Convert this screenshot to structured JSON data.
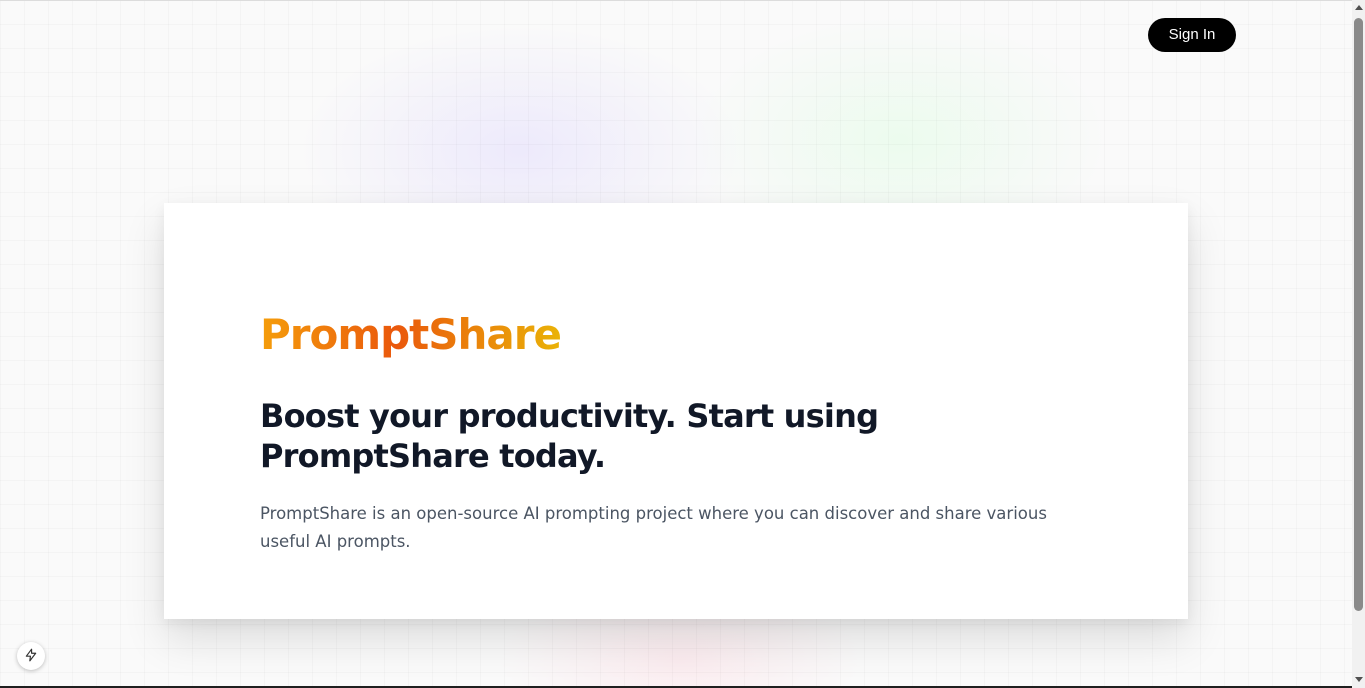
{
  "header": {
    "sign_in_label": "Sign In"
  },
  "hero": {
    "brand": "PromptShare",
    "headline": "Boost your productivity. Start using PromptShare today.",
    "description": "PromptShare is an open-source AI prompting project where you can discover and share various useful AI prompts."
  },
  "colors": {
    "brand_gradient": [
      "#f59e0b",
      "#ea580c",
      "#eab308"
    ],
    "headline": "#111827",
    "description": "#4b5563",
    "button_bg": "#000000",
    "button_text": "#ffffff"
  },
  "icons": {
    "dev_badge": "lightning-bolt-icon"
  }
}
